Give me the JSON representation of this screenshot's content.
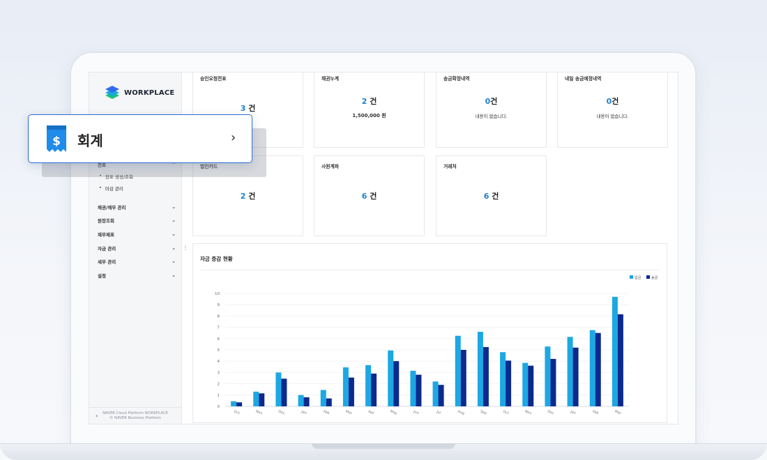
{
  "sidebar": {
    "logo_text": "WORKPLACE",
    "section_label": "전표",
    "sub_items": [
      "전표 생성/조회",
      "마감 관리"
    ],
    "menu": [
      "채권/채무 관리",
      "원장조회",
      "재무제표",
      "자금 관리",
      "세무 관리",
      "설정"
    ],
    "footer_line1": "NAVER Cloud Platform WORKPLACE",
    "footer_line2": "© NAVER Business Platform"
  },
  "popup": {
    "label": "회계"
  },
  "cards": [
    {
      "title": "승인요청전표",
      "count": "3",
      "unit": "건",
      "sub": ""
    },
    {
      "title": "채권누계",
      "count": "2",
      "unit": "건",
      "sub": "1,500,000 원"
    },
    {
      "title": "송금확정내역",
      "count": "0",
      "unit": "건",
      "sub": "내용이 없습니다."
    },
    {
      "title": "내일 송금예정내역",
      "count": "0",
      "unit": "건",
      "sub": "내용이 없습니다."
    },
    {
      "title": "법인카드",
      "count": "2",
      "unit": "건",
      "sub": ""
    },
    {
      "title": "사원계좌",
      "count": "6",
      "unit": "건",
      "sub": ""
    },
    {
      "title": "거래처",
      "count": "6",
      "unit": "건",
      "sub": ""
    }
  ],
  "chart_data": {
    "type": "bar",
    "title": "자금 증감 현황",
    "xlabel": "",
    "ylabel": "",
    "ylim": [
      0,
      10
    ],
    "yticks": [
      0,
      1,
      2,
      3,
      4,
      5,
      6,
      7,
      8,
      9,
      10
    ],
    "legend_position": "top-right",
    "categories": [
      "Oct",
      "Nov",
      "Dec",
      "Jan",
      "Feb",
      "Mar",
      "Apr",
      "May",
      "Jun",
      "Jul",
      "Aug",
      "Sep",
      "Oct",
      "Nov",
      "Dec",
      "Jan",
      "Feb",
      "Mar"
    ],
    "series": [
      {
        "name": "입금",
        "color": "#1ca8e3",
        "values": [
          0.45,
          1.3,
          3.0,
          1.0,
          1.45,
          3.45,
          3.65,
          4.95,
          3.15,
          2.2,
          6.25,
          6.6,
          4.8,
          3.85,
          5.3,
          6.15,
          6.75,
          9.7
        ]
      },
      {
        "name": "송금",
        "color": "#0b2a8f",
        "values": [
          0.35,
          1.15,
          2.45,
          0.8,
          0.7,
          2.55,
          2.9,
          4.0,
          2.8,
          1.9,
          5.0,
          5.25,
          4.05,
          3.6,
          4.2,
          5.2,
          6.5,
          8.15
        ]
      }
    ]
  }
}
